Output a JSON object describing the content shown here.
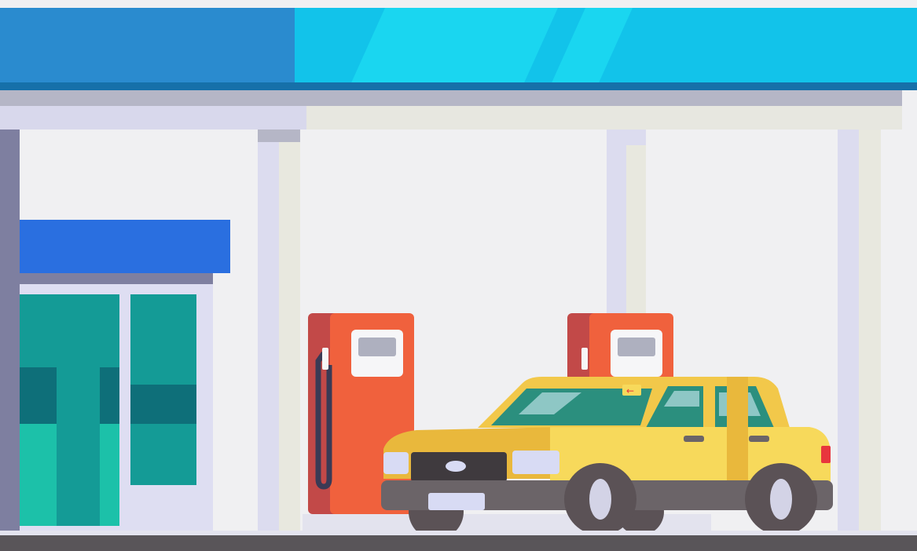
{
  "scene": {
    "subject": "gas-station-illustration",
    "elements": [
      "canopy",
      "convenience-store",
      "fuel-pump-left",
      "fuel-pump-right",
      "taxi-car",
      "ground"
    ]
  },
  "colors": {
    "background": "#f0f0f2",
    "canopy_dark": "#2a8bcf",
    "canopy_light": "#12c3ea",
    "canopy_highlight": "#1ad6f0",
    "canopy_trim": "#1670a9",
    "beam_shadow": "#b5b6c6",
    "beam_light": "#e7e7e0",
    "beam_purple": "#d8d8ec",
    "pillar_light": "#dcdcef",
    "pillar_shade": "#e8e8df",
    "store_awning": "#2a6fe0",
    "store_frame": "#7e7fa0",
    "store_wall": "#dedef2",
    "store_window": "#149b96",
    "store_window_dark": "#0e6f79",
    "store_window_light": "#1cc1a9",
    "pump_body": "#f0613d",
    "pump_side": "#c24948",
    "pump_screen_frame": "#f6f6f8",
    "pump_screen": "#aeb0bf",
    "pump_hose": "#3a3a55",
    "car_body": "#f7d95b",
    "car_body_shade": "#e9b83c",
    "car_roof": "#f2c84a",
    "car_window": "#2b8f7e",
    "car_window_light": "#8ec7c5",
    "car_bumper": "#6b6468",
    "car_grille": "#3f3a3e",
    "car_headlight": "#d8dbf4",
    "car_tire": "#5b5256",
    "car_rim": "#d3d3e6",
    "car_taillight": "#e8363d",
    "ground": "#595559",
    "ground_edge": "#e3e3ee"
  }
}
